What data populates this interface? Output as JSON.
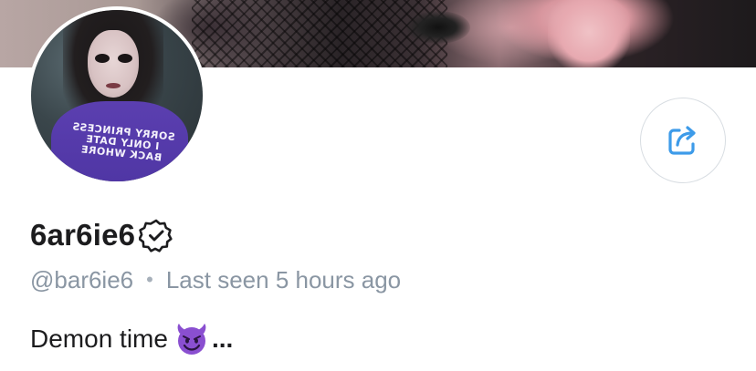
{
  "profile": {
    "display_name": "6ar6ie6",
    "handle": "@bar6ie6",
    "separator": "•",
    "last_seen": "Last seen 5 hours ago",
    "bio_text": "Demon time",
    "bio_ellipsis": "...",
    "verified": true
  },
  "avatar": {
    "shirt_lines": [
      "SORRY PRINCESS",
      "I ONLY DATE",
      "BACK WHORE"
    ]
  },
  "icons": {
    "share": "share-icon",
    "verified": "verified-badge-icon",
    "bio_emoji": "smiling-devil-emoji"
  },
  "colors": {
    "accent": "#3d9be9",
    "text_primary": "#1c1c1e",
    "text_secondary": "#8a96a3",
    "border": "#d8dde2",
    "devil_purple": "#8a4fd0"
  }
}
